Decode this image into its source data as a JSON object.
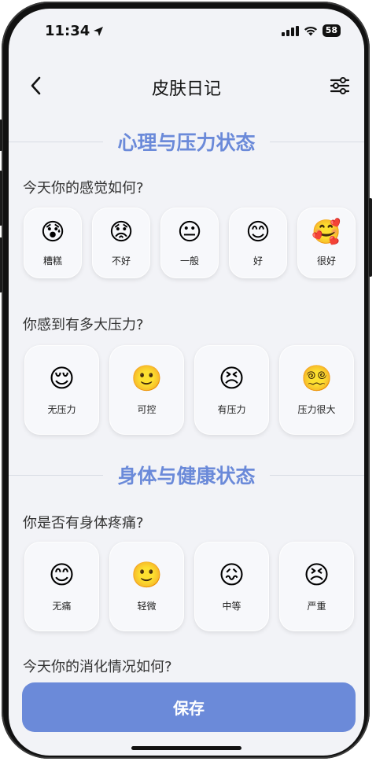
{
  "status_bar": {
    "time": "11:34",
    "battery": "58"
  },
  "nav": {
    "title": "皮肤日记",
    "back_icon": "chevron-left-icon",
    "filter_icon": "sliders-icon"
  },
  "sections": [
    {
      "title": "心理与压力状态"
    },
    {
      "title": "身体与健康状态"
    }
  ],
  "questions": {
    "mood": {
      "text": "今天你的感觉如何?",
      "options": [
        {
          "emoji": "😰",
          "label": "糟糕"
        },
        {
          "emoji": "😟",
          "label": "不好"
        },
        {
          "emoji": "😐",
          "label": "一般"
        },
        {
          "emoji": "😊",
          "label": "好"
        },
        {
          "emoji": "🥰",
          "label": "很好"
        }
      ]
    },
    "stress": {
      "text": "你感到有多大压力?",
      "options": [
        {
          "emoji": "😌",
          "label": "无压力"
        },
        {
          "emoji": "🙂",
          "label": "可控"
        },
        {
          "emoji": "😣",
          "label": "有压力"
        },
        {
          "emoji": "😵‍💫",
          "label": "压力很大"
        }
      ]
    },
    "pain": {
      "text": "你是否有身体疼痛?",
      "options": [
        {
          "emoji": "😊",
          "label": "无痛"
        },
        {
          "emoji": "🙂",
          "label": "轻微"
        },
        {
          "emoji": "😖",
          "label": "中等"
        },
        {
          "emoji": "😣",
          "label": "严重"
        }
      ]
    },
    "digestion": {
      "text": "今天你的消化情况如何?"
    }
  },
  "save_label": "保存",
  "colors": {
    "accent": "#6b8ad9",
    "background": "#f2f3f7"
  }
}
